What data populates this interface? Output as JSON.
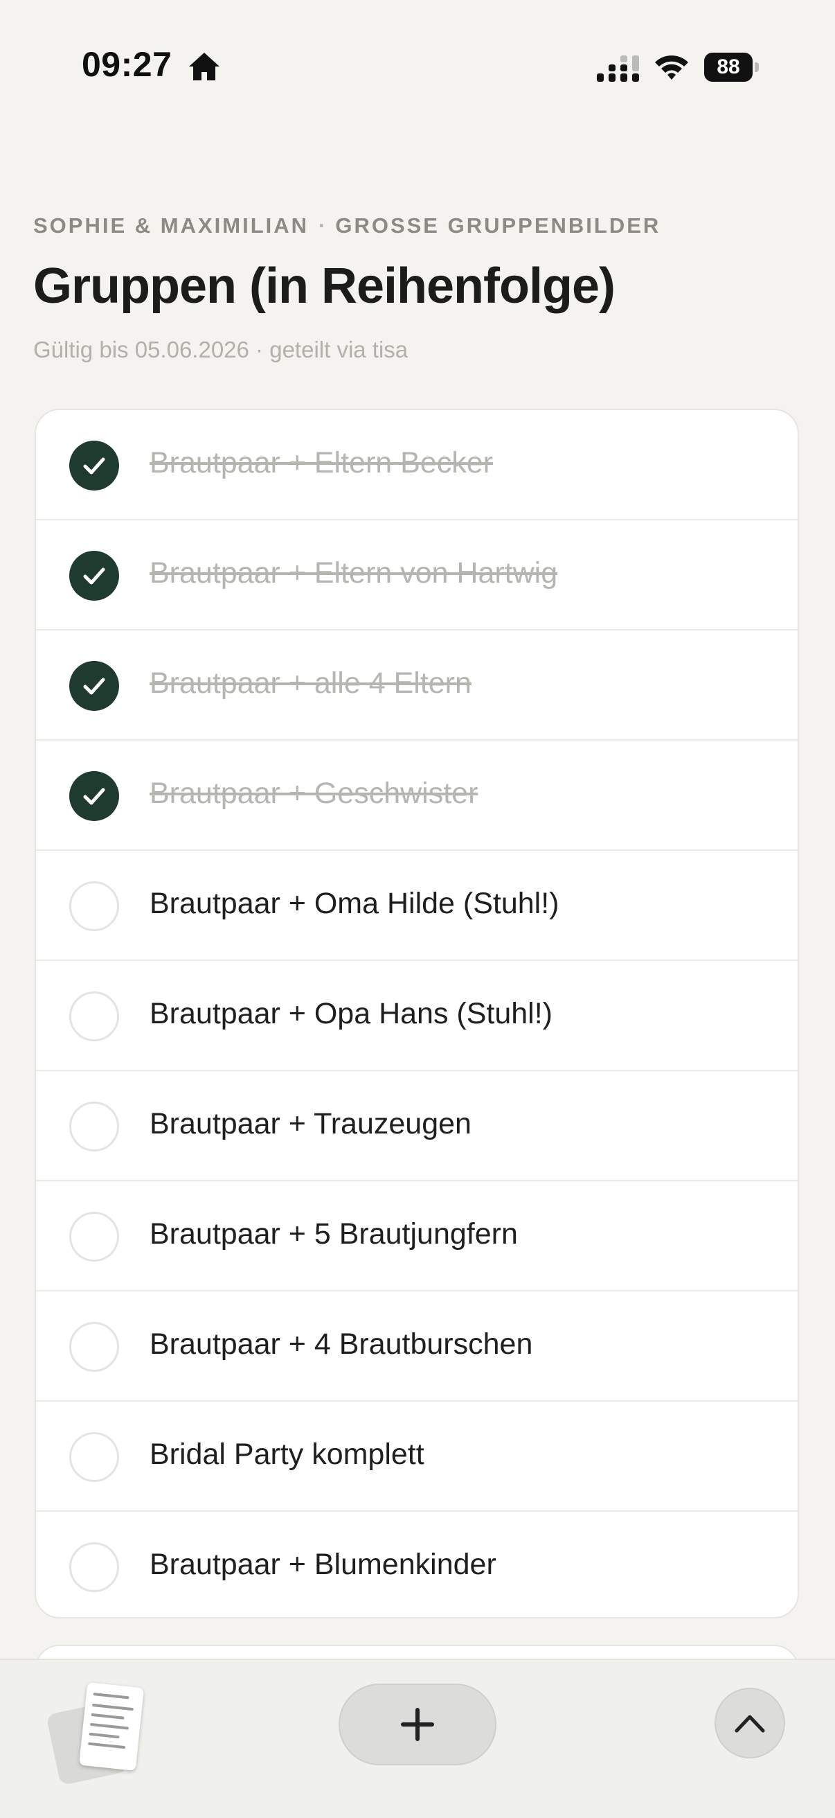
{
  "status_bar": {
    "time": "09:27",
    "battery": "88",
    "icons": [
      "home-icon",
      "signal-icon",
      "wifi-icon",
      "battery-icon"
    ]
  },
  "header": {
    "breadcrumb_left": "SOPHIE & MAXIMILIAN",
    "breadcrumb_sep": "·",
    "breadcrumb_right": "GROSSE GRUPPENBILDER",
    "title": "Gruppen (in Reihenfolge)",
    "subtitle": "Gültig bis 05.06.2026 · geteilt via tisa"
  },
  "list": {
    "items": [
      {
        "label": "Brautpaar + Eltern Becker",
        "done": true
      },
      {
        "label": "Brautpaar + Eltern von Hartwig",
        "done": true
      },
      {
        "label": "Brautpaar + alle 4 Eltern",
        "done": true
      },
      {
        "label": "Brautpaar + Geschwister",
        "done": true
      },
      {
        "label": "Brautpaar + Oma Hilde (Stuhl!)",
        "done": false
      },
      {
        "label": "Brautpaar + Opa Hans (Stuhl!)",
        "done": false
      },
      {
        "label": "Brautpaar + Trauzeugen",
        "done": false
      },
      {
        "label": "Brautpaar + 5 Brautjungfern",
        "done": false
      },
      {
        "label": "Brautpaar + 4 Brautburschen",
        "done": false
      },
      {
        "label": "Bridal Party komplett",
        "done": false
      },
      {
        "label": "Brautpaar + Blumenkinder",
        "done": false
      }
    ]
  },
  "bottom_bar": {
    "icons": [
      "documents-stack-icon",
      "plus-icon",
      "chevron-up-icon"
    ]
  },
  "colors": {
    "background": "#f4f3f0",
    "check_done": "#1f3a2e",
    "done_text": "#b6b5af",
    "card": "#ffffff"
  }
}
